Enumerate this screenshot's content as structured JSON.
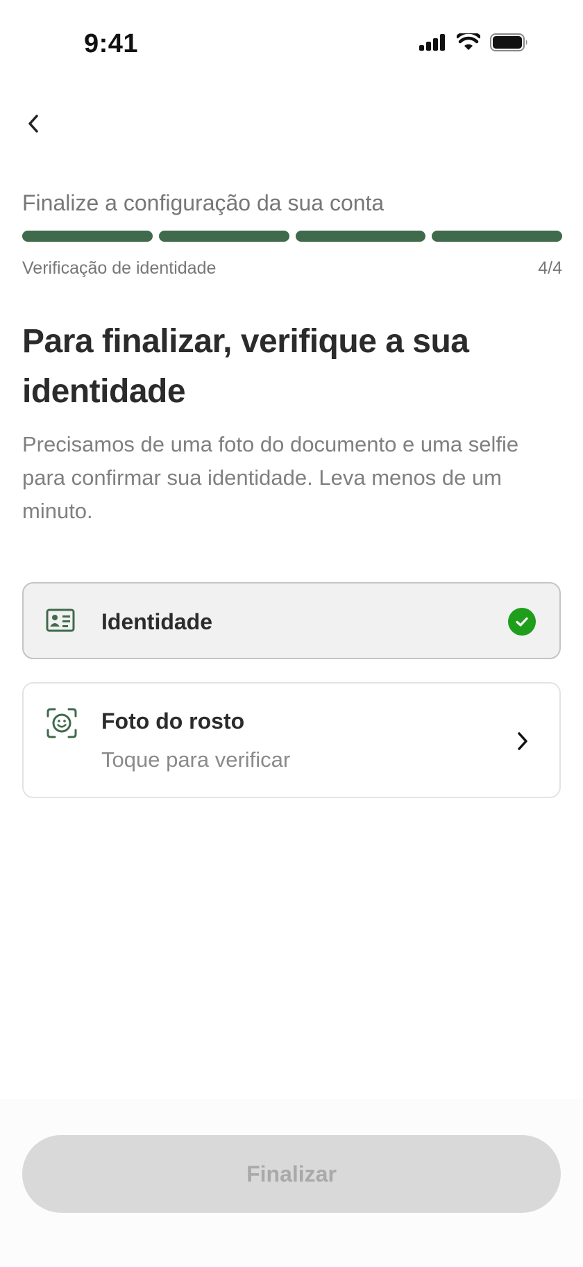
{
  "status_bar": {
    "time": "9:41"
  },
  "progress": {
    "title": "Finalize a configuração da sua conta",
    "step_label": "Verificação de identidade",
    "step_count": "4/4",
    "segments_total": 4,
    "segments_completed": 4,
    "color": "#3f6a4b"
  },
  "main": {
    "heading": "Para finalizar, verifique a sua identidade",
    "description": "Precisamos de uma foto do documento e uma selfie para confirmar sua identidade. Leva menos de um minuto."
  },
  "items": [
    {
      "label": "Identidade",
      "icon": "id-card-icon",
      "status": "completed",
      "status_icon": "check-circle-icon"
    },
    {
      "label": "Foto do rosto",
      "subtitle": "Toque para verificar",
      "icon": "face-scan-icon",
      "status_icon": "chevron-right-icon"
    }
  ],
  "footer": {
    "button_label": "Finalizar",
    "button_enabled": false
  },
  "colors": {
    "accent": "#3f6a4b",
    "success": "#1f9e1b",
    "disabled_button": "#d9d9d9"
  }
}
